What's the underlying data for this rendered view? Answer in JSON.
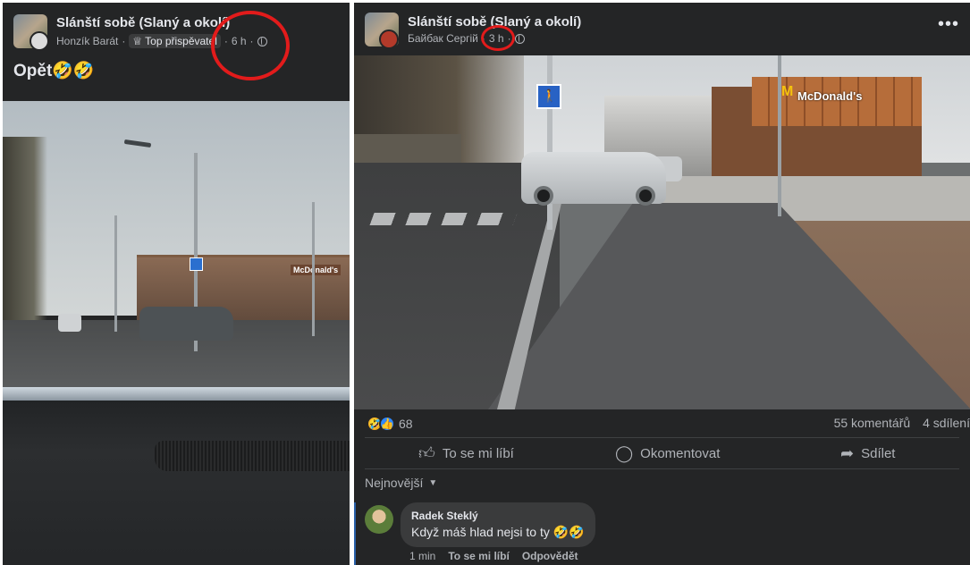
{
  "left_post": {
    "group_name": "Slánští sobě (Slaný a okolí)",
    "author": "Honzík Barát",
    "badge": "Top přispěvatel",
    "time": "6 h",
    "separator": "·",
    "text": "Opět🤣🤣",
    "photo_labels": {
      "mcdonalds_sign": "McDonald's"
    }
  },
  "right_post": {
    "group_name": "Slánští sobě (Slaný a okolí)",
    "author": "Байбак Сергій",
    "time": "3 h",
    "separator": "·",
    "more_menu": "•••",
    "photo_labels": {
      "mcdonalds_m": "M",
      "mcdonalds_sign": "McDonald's"
    },
    "reactions": {
      "emoji": [
        "🤣",
        "👍"
      ],
      "count": "68"
    },
    "stats": {
      "comments": "55 komentářů",
      "shares": "4 sdílení"
    },
    "actions": {
      "like": "To se mi líbí",
      "comment": "Okomentovat",
      "share": "Sdílet"
    },
    "sort_label": "Nejnovější",
    "comment": {
      "author": "Radek Steklý",
      "text": "Když máš hlad nejsi to ty 🤣🤣",
      "time": "1 min",
      "like": "To se mi líbí",
      "reply": "Odpovědět"
    }
  },
  "colors": {
    "panel_bg": "#242526",
    "text_primary": "#e4e6eb",
    "text_secondary": "#b0b3b8",
    "annotation_red": "#e21b1b"
  }
}
